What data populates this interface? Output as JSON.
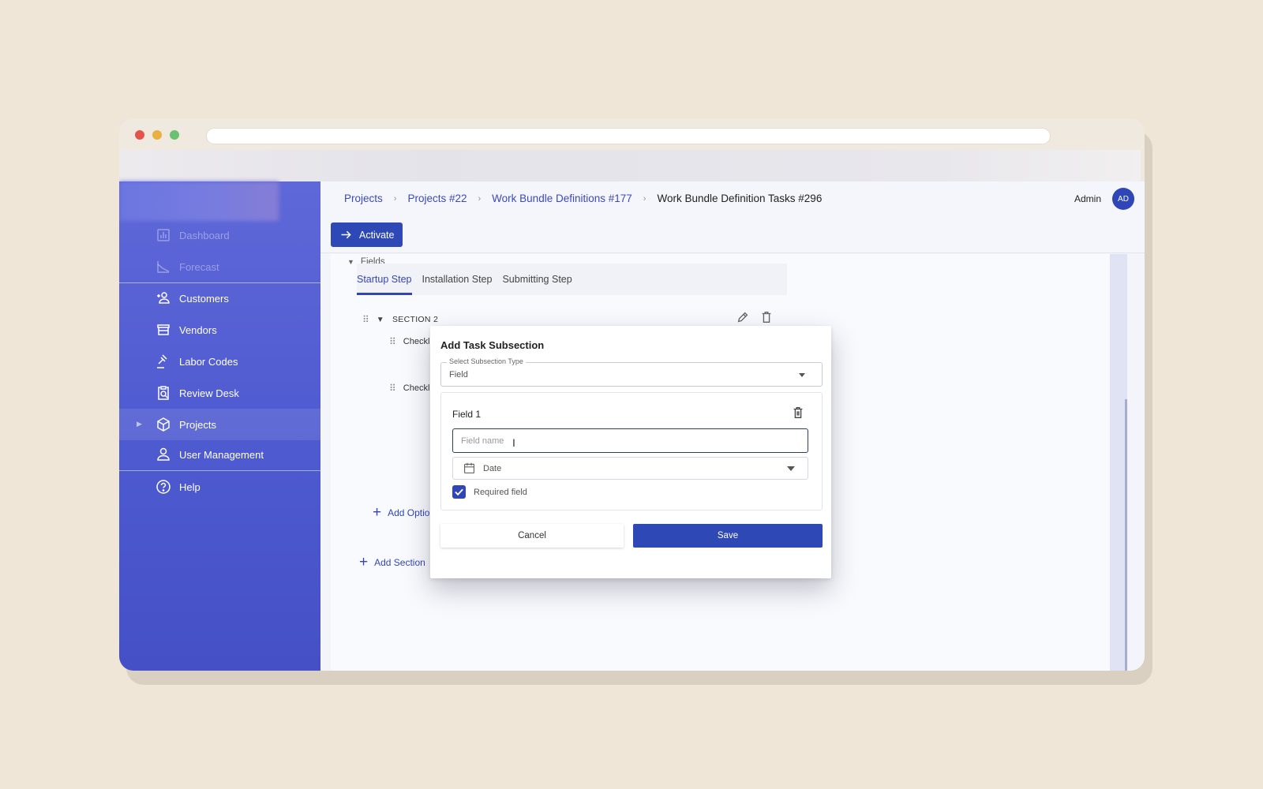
{
  "sidebar": {
    "items": [
      {
        "label": "Dashboard",
        "icon": "chart-icon"
      },
      {
        "label": "Forecast",
        "icon": "forecast-icon"
      },
      {
        "label": "Customers",
        "icon": "add-user-icon"
      },
      {
        "label": "Vendors",
        "icon": "store-icon"
      },
      {
        "label": "Labor Codes",
        "icon": "gavel-icon"
      },
      {
        "label": "Review Desk",
        "icon": "clipboard-search-icon"
      },
      {
        "label": "Projects",
        "icon": "cube-icon"
      },
      {
        "label": "User Management",
        "icon": "person-icon"
      },
      {
        "label": "Help",
        "icon": "help-icon"
      }
    ]
  },
  "breadcrumb": {
    "items": [
      "Projects",
      "Projects #22",
      "Work Bundle Definitions #177"
    ],
    "current": "Work Bundle Definition Tasks #296"
  },
  "user": {
    "name": "Admin",
    "initials": "AD"
  },
  "toolbar": {
    "activate_label": "Activate"
  },
  "fields": {
    "toggle_label": "Fields",
    "tabs": [
      "Startup Step",
      "Installation Step",
      "Submitting Step"
    ],
    "section_title": "SECTION 2",
    "sub_rows": [
      "Checkl",
      "Checkl"
    ],
    "add_option_label": "Add Optio",
    "add_section_label": "Add Section"
  },
  "modal": {
    "title": "Add Task Subsection",
    "subsection_type_label": "Select Subsection Type",
    "subsection_type_value": "Field",
    "field_title": "Field 1",
    "field_name_placeholder": "Field name",
    "field_type_value": "Date",
    "required_label": "Required field",
    "required_checked": true,
    "cancel_label": "Cancel",
    "save_label": "Save"
  },
  "colors": {
    "sidebar": "#4f5bd1",
    "accent": "#2e48b5",
    "link": "#3d49b8"
  }
}
